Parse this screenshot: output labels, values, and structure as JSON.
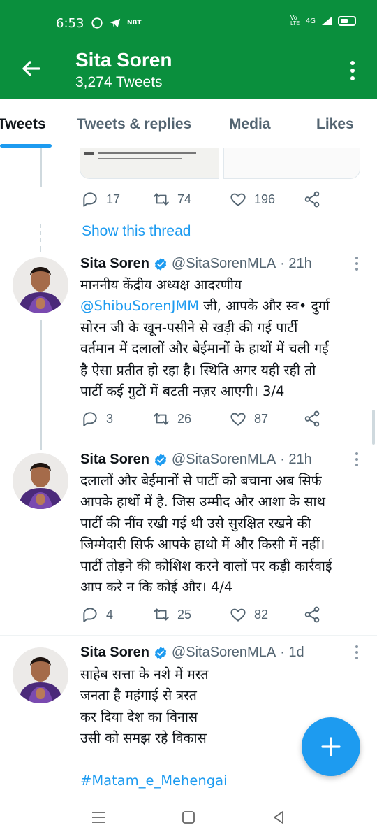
{
  "status_bar": {
    "time": "6:53",
    "carrier_badge": "NBT",
    "network": "4G",
    "volte": "Vo LTE",
    "icons": [
      "whatsapp-icon",
      "telegram-icon",
      "signal-icon",
      "battery-icon"
    ]
  },
  "header": {
    "title": "Sita Soren",
    "subtitle": "3,274 Tweets",
    "back_icon": "arrow-left-icon",
    "menu_icon": "more-vertical-icon",
    "bar_color": "#0a8f3d"
  },
  "tabs": [
    {
      "label": "Tweets",
      "active": true
    },
    {
      "label": "Tweets & replies",
      "active": false
    },
    {
      "label": "Media",
      "active": false
    },
    {
      "label": "Likes",
      "active": false
    }
  ],
  "prev_tweet": {
    "stats": {
      "replies": "17",
      "retweets": "74",
      "likes": "196"
    },
    "show_thread": "Show this thread"
  },
  "tweets": [
    {
      "name": "Sita Soren",
      "handle": "@SitaSorenMLA",
      "time": "· 21h",
      "lines": [
        "माननीय केंद्रीय अध्यक्ष आदरणीय",
        "@ShibuSorenJMM",
        " जी, आपके और स्व• दुर्गा",
        "सोरन जी के खून-पसीने से खड़ी की गई पार्टी",
        "वर्तमान में दलालों और बेईमानों के हाथों में चली गई",
        "है ऐसा प्रतीत हो रहा है। स्थिति अगर यही रही तो",
        "पार्टी कई गुटों में बटती नज़र आएगी। 3/4"
      ],
      "stats": {
        "replies": "3",
        "retweets": "26",
        "likes": "87"
      }
    },
    {
      "name": "Sita Soren",
      "handle": "@SitaSorenMLA",
      "time": "· 21h",
      "lines": [
        "दलालों और बेईमानों से पार्टी को बचाना अब सिर्फ",
        "आपके हाथों में है. जिस उम्मीद और आशा के साथ",
        "पार्टी की नींव रखी गई थी उसे सुरक्षित रखने की",
        "जिम्मेदारी सिर्फ आपके हाथो में और किसी में नहीं।",
        "पार्टी तोड़ने की कोशिश करने वालों पर कड़ी कार्रवाई",
        "आप करे न कि कोई और। 4/4"
      ],
      "stats": {
        "replies": "4",
        "retweets": "25",
        "likes": "82"
      }
    },
    {
      "name": "Sita Soren",
      "handle": "@SitaSorenMLA",
      "time": "· 1d",
      "lines": [
        "साहेब सत्ता के नशे में मस्त",
        "जनता है महंगाई से त्रस्त",
        "कर दिया देश का विनास",
        "उसी को समझ रहे विकास",
        "",
        "#Matam_e_Mehengai"
      ]
    }
  ],
  "fab": {
    "icon": "plus-icon",
    "color": "#1d9bf0"
  },
  "nav": [
    "menu-icon",
    "home-square-icon",
    "back-triangle-icon"
  ],
  "colors": {
    "accent": "#1d9bf0",
    "muted": "#536471",
    "brand_green": "#0a8f3d"
  }
}
